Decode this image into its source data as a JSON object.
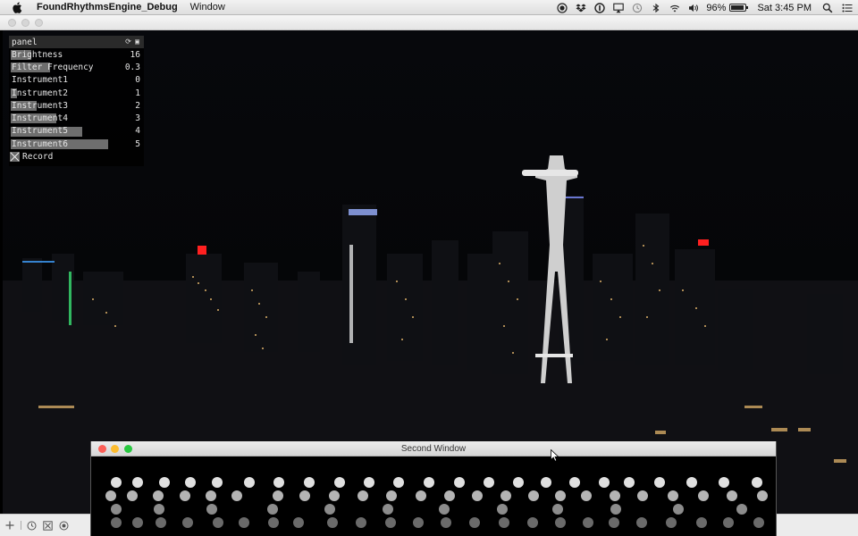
{
  "menubar": {
    "app_name": "FoundRhythmsEngine_Debug",
    "menus": [
      "Window"
    ],
    "battery": "96%",
    "battery_level": 0.96,
    "clock": "Sat 3:45 PM",
    "icons": [
      "apple-icon",
      "record-icon",
      "dropbox-icon",
      "onepassword-icon",
      "airplay-icon",
      "time-machine-icon",
      "bluetooth-icon",
      "wifi-icon",
      "volume-icon",
      "battery-icon",
      "spotlight-icon",
      "notification-list-icon"
    ]
  },
  "panel": {
    "title": "panel",
    "params": [
      {
        "label": "Brightness",
        "value": "16",
        "fill": 0.16
      },
      {
        "label": "Filter Frequency",
        "value": "0.3",
        "fill": 0.3
      },
      {
        "label": "Instrument1",
        "value": "0",
        "fill": 0.0
      },
      {
        "label": "Instrument2",
        "value": "1",
        "fill": 0.05
      },
      {
        "label": "Instrument3",
        "value": "2",
        "fill": 0.2
      },
      {
        "label": "Instrument4",
        "value": "3",
        "fill": 0.35
      },
      {
        "label": "Instrument5",
        "value": "4",
        "fill": 0.55
      },
      {
        "label": "Instrument6",
        "value": "5",
        "fill": 0.75
      }
    ],
    "record_label": "Record",
    "record_checked": true
  },
  "second_window": {
    "title": "Second Window"
  },
  "colors": {
    "panel_bar": "#6e6e6e",
    "dot_bright": "#e0e0e0",
    "dot_mid": "#b4b4b4",
    "dot_dim": "#8c8c8c",
    "dot_dark": "#6a6a6a",
    "close_red": "#fc5f57",
    "minimize_yellow": "#fdbc2e",
    "zoom_green": "#28c840"
  }
}
